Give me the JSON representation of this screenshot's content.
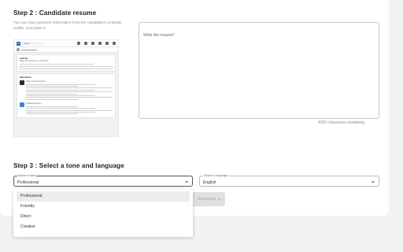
{
  "step2": {
    "title": "Step 2 : Candidate resume",
    "hint": "You can copy pertinent information from the candidate's LinkedIn profile, and paste it",
    "resume_placeholder": "Write the resume",
    "required_mark": "*",
    "remaining": "4000 characters remaining"
  },
  "linkedin_preview": {
    "logo": "in",
    "search": "Search",
    "about_title": "Activity",
    "about_line": "About to the public eye of LinkedIn",
    "experience_title": "Experience",
    "job1": "Sales Lifelong Lifestyle",
    "job2": "Software Engineer"
  },
  "step3": {
    "title": "Step 3 : Select a tone and language",
    "tone": {
      "label": "Select a tone",
      "value": "Professional",
      "options": [
        "Professional",
        "Friendly",
        "Direct",
        "Creative"
      ],
      "selected_index": 0
    },
    "language": {
      "label": "Select a language",
      "value": "English"
    },
    "generate_label": "Messages"
  },
  "icons": {
    "chevron_up": "chevron-up-icon",
    "chevron_down": "chevron-down-icon",
    "sparkle": "sparkle-icon"
  },
  "colors": {
    "page_bg": "#f2f2f3",
    "card_bg": "#ffffff",
    "required": "#dd3333",
    "linkedin_blue": "#0a66c2"
  }
}
